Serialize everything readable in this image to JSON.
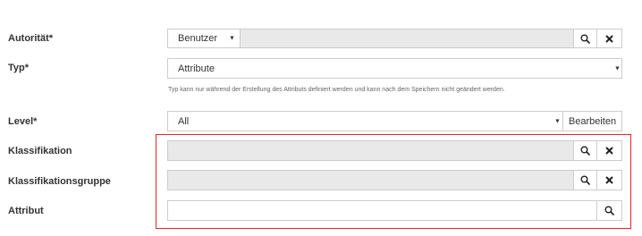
{
  "autoritaet": {
    "label": "Autorität*",
    "select_value": "Benutzer",
    "search_icon": "search-icon",
    "clear_icon": "close-icon"
  },
  "typ": {
    "label": "Typ*",
    "select_value": "Attribute",
    "help_text": "Typ kann nur während der Erstellung des Attributs definiert werden und kann nach dem Speichern nicht geändert werden."
  },
  "level": {
    "label": "Level*",
    "select_value": "All",
    "edit_label": "Bearbeiten"
  },
  "klassifikation": {
    "label": "Klassifikation",
    "search_icon": "search-icon",
    "clear_icon": "close-icon"
  },
  "klassifikationsgruppe": {
    "label": "Klassifikationsgruppe",
    "search_icon": "search-icon",
    "clear_icon": "close-icon"
  },
  "attribut": {
    "label": "Attribut",
    "search_icon": "search-icon"
  },
  "colors": {
    "highlight": "#e5262e",
    "readonly_field": "#e9e9e9",
    "border": "#cccccc"
  }
}
